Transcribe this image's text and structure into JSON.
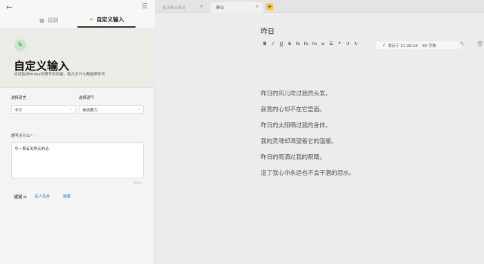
{
  "left": {
    "back_icon": "arrow-left-icon",
    "collapse_icon": "collapse-icon",
    "tabs": [
      {
        "label": "提纲",
        "icon": "outline-icon"
      },
      {
        "label": "自定义输入",
        "icon": "sparkle-icon"
      }
    ],
    "hero": {
      "icon": "pencil-icon",
      "title": "自定义输入",
      "description": "试试告诉Friday你想写的内容，她几乎什么都能帮你写"
    },
    "language": {
      "label": "选择语言",
      "value": "中文"
    },
    "tone": {
      "label": "选择语气",
      "value": "有说服力"
    },
    "prompt": {
      "label": "想写点什么",
      "required_mark": "*",
      "value": "写一首有关昨天的诗",
      "counter": "9/500"
    },
    "try": {
      "label": "试试",
      "links": [
        "名人名言",
        "故事"
      ]
    }
  },
  "editor": {
    "tabs": [
      {
        "label": "有关昨天的诗"
      },
      {
        "label": "昨日"
      }
    ],
    "add_tab": "+",
    "doc_title": "昨日",
    "toolbar": [
      "B",
      "I",
      "U",
      "S",
      "H₁",
      "H₂",
      "H₃",
      "≡",
      "☰",
      "❝",
      "↺",
      "↻"
    ],
    "save_status": {
      "text": "保存于 11:28:18",
      "words": "69 字数"
    },
    "poem": [
      "昨日的风儿吹过我的头发，",
      "寂寞的心却不在它里面。",
      "昨日的太阳晒过我的身体，",
      "我的灵魂却渴望着它的温暖。",
      "昨日的雨洒过我的眼睛，",
      "湿了我心中永远也不会干涸的泪水。"
    ]
  },
  "colors": {
    "accent": "#f3c63d",
    "link": "#1e73e0",
    "pen_bg": "#c8e6cc"
  }
}
